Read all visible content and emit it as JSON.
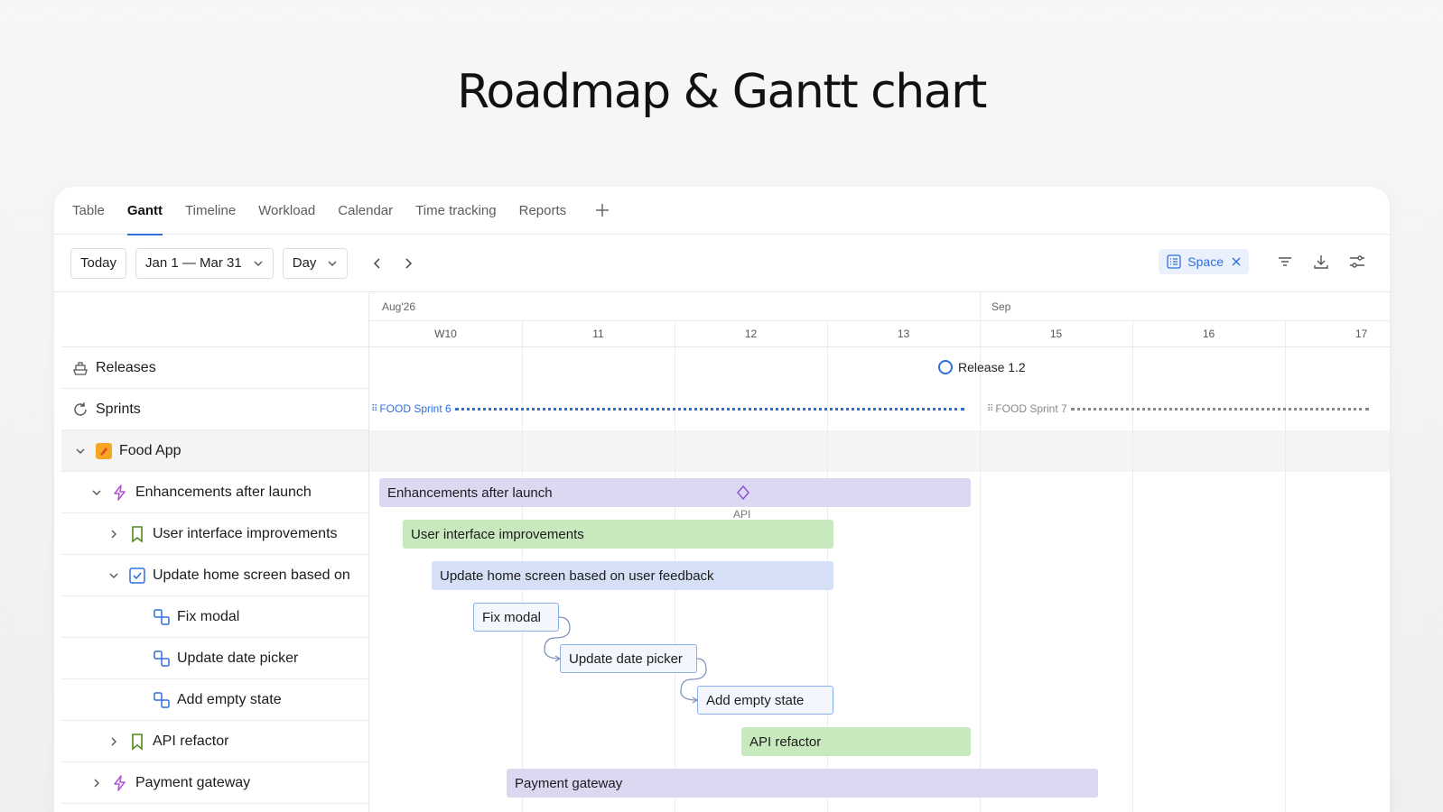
{
  "hero": {
    "title": "Roadmap & Gantt chart"
  },
  "tabs": [
    {
      "label": "Table"
    },
    {
      "label": "Gantt"
    },
    {
      "label": "Timeline"
    },
    {
      "label": "Workload"
    },
    {
      "label": "Calendar"
    },
    {
      "label": "Time tracking"
    },
    {
      "label": "Reports"
    }
  ],
  "tab_add": "+",
  "active_tab": "Gantt",
  "toolbar": {
    "today": "Today",
    "range": "Jan 1 — Mar 31",
    "scale": "Day",
    "filter_chip": "Space"
  },
  "timeline": {
    "months": [
      {
        "label": "Aug'26"
      },
      {
        "label": "Sep"
      }
    ],
    "weeks": [
      "W10",
      "11",
      "12",
      "13",
      "15",
      "16",
      "17"
    ]
  },
  "rows": {
    "releases": "Releases",
    "sprints": "Sprints",
    "project": "Food App",
    "epic1": "Enhancements after launch",
    "story1": "User interface improvements",
    "task1": "Update home screen based on",
    "sub1": "Fix modal",
    "sub2": "Update date picker",
    "sub3": "Add empty state",
    "story2": "API refactor",
    "epic2": "Payment gateway"
  },
  "bars": {
    "release": "Release 1.2",
    "sprint6": "FOOD Sprint 6",
    "sprint7": "FOOD Sprint 7",
    "epic1": "Enhancements after launch",
    "milestone": "API",
    "story1": "User interface improvements",
    "task1": "Update home screen based on user feedback",
    "sub1": "Fix modal",
    "sub2": "Update date picker",
    "sub3": "Add empty state",
    "story2": "API refactor",
    "epic2": "Payment gateway"
  },
  "colors": {
    "accent": "#2f6fdc",
    "epic": "#ddd8f2",
    "story": "#c8e9bd",
    "task": "#d5e0f7",
    "epic_icon": "#b14fd8",
    "story_icon": "#4f8a1c",
    "project_icon": "#f5a623"
  },
  "icons": {
    "releases": "ship-icon",
    "sprints": "refresh-icon",
    "epic": "lightning-icon",
    "story": "bookmark-icon",
    "task": "checkbox-icon",
    "subtask": "subtask-icon"
  }
}
